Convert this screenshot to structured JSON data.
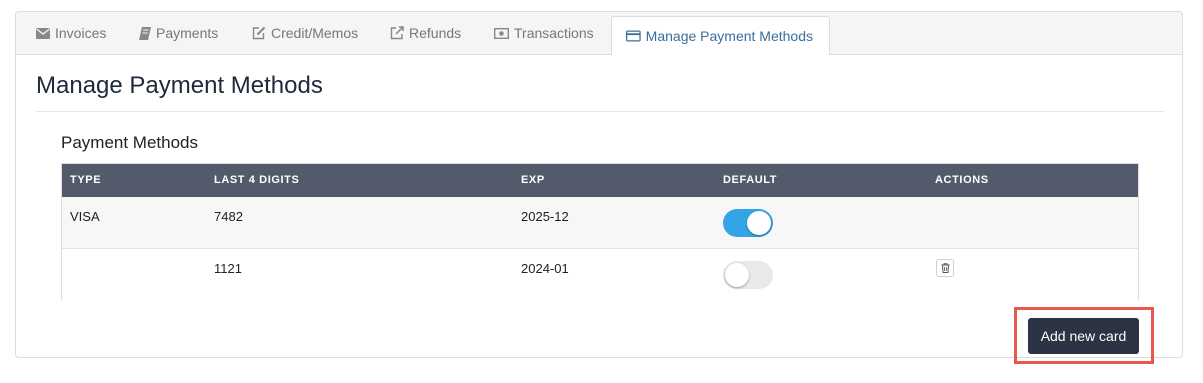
{
  "tabs": [
    {
      "label": "Invoices",
      "icon": "envelope-icon",
      "active": false
    },
    {
      "label": "Payments",
      "icon": "book-icon",
      "active": false
    },
    {
      "label": "Credit/Memos",
      "icon": "edit-icon",
      "active": false
    },
    {
      "label": "Refunds",
      "icon": "external-link-icon",
      "active": false
    },
    {
      "label": "Transactions",
      "icon": "money-icon",
      "active": false
    },
    {
      "label": "Manage Payment Methods",
      "icon": "credit-card-icon",
      "active": true
    }
  ],
  "page_title": "Manage Payment Methods",
  "section_title": "Payment Methods",
  "table": {
    "columns": [
      "TYPE",
      "LAST 4 DIGITS",
      "EXP",
      "DEFAULT",
      "ACTIONS"
    ],
    "rows": [
      {
        "type": "VISA",
        "last4": "7482",
        "exp": "2025-12",
        "default": true,
        "actions": []
      },
      {
        "type": "",
        "last4": "1121",
        "exp": "2024-01",
        "default": false,
        "actions": [
          "delete"
        ]
      }
    ]
  },
  "add_button_label": "Add new card",
  "colors": {
    "header_bg": "#525a6b",
    "toggle_on": "#33a5e6",
    "active_tab_text": "#3a6e9c",
    "button_bg": "#2b3344",
    "highlight_border": "#e8574d"
  }
}
